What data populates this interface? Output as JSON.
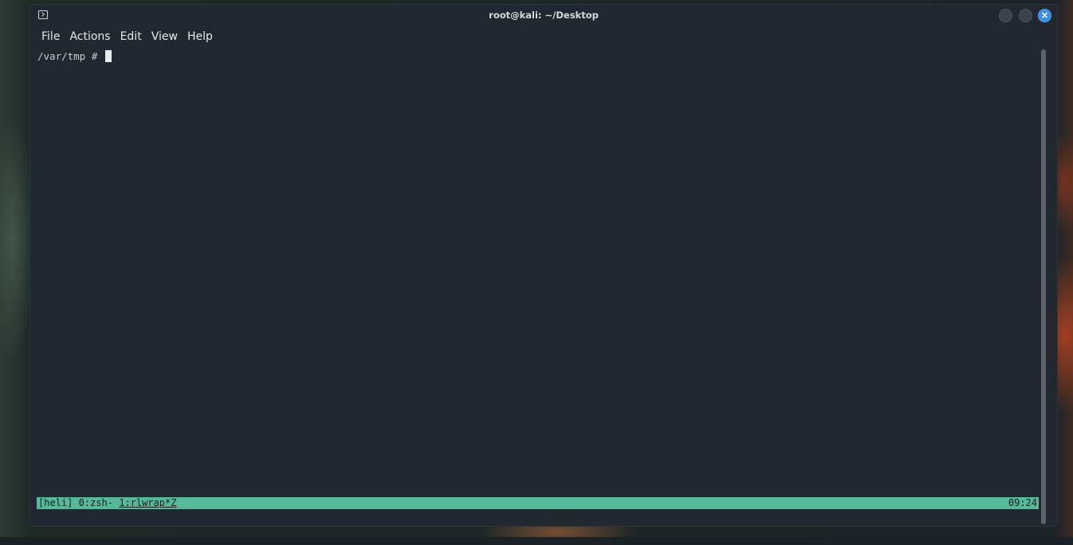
{
  "window": {
    "title": "root@kali: ~/Desktop",
    "icon": "terminal-icon",
    "close_symbol": "×",
    "accent_close": "#3a8de0"
  },
  "menubar": {
    "items": [
      {
        "label": "File"
      },
      {
        "label": "Actions"
      },
      {
        "label": "Edit"
      },
      {
        "label": "View"
      },
      {
        "label": "Help"
      }
    ]
  },
  "terminal": {
    "prompt": "/var/tmp # "
  },
  "statusbar": {
    "session": "[heli]",
    "window0": "0:zsh-",
    "window1": "1:rlwrap*Z",
    "time": "09:24",
    "color": "#57b89b"
  }
}
